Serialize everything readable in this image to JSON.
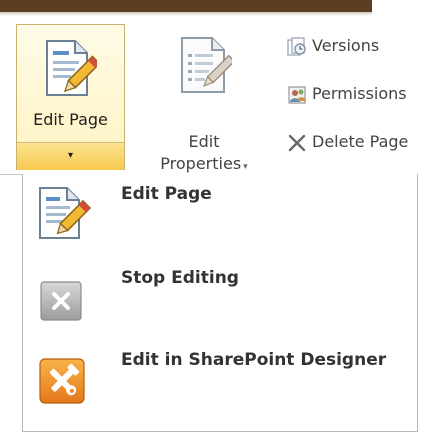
{
  "ribbon": {
    "edit_page": {
      "label": "Edit Page",
      "arrow": "▾"
    },
    "edit_properties": {
      "line1": "Edit",
      "line2": "Properties",
      "arrow": "▾"
    },
    "versions": {
      "label": "Versions",
      "icon": "versions-icon"
    },
    "permissions": {
      "label": "Permissions",
      "icon": "permissions-icon"
    },
    "delete_page": {
      "label": "Delete Page",
      "icon": "close-x-icon"
    }
  },
  "menu": {
    "items": [
      {
        "label": "Edit Page",
        "icon": "edit-page-icon"
      },
      {
        "label": "Stop Editing",
        "icon": "stop-editing-icon"
      },
      {
        "label": "Edit in SharePoint Designer",
        "icon": "sharepoint-designer-icon"
      }
    ]
  },
  "colors": {
    "top_bar": "#5a3f22",
    "split_hover_bg": "#fff3c2",
    "split_arrow_bg": "#f7c94f",
    "designer_orange": "#f0961e"
  }
}
